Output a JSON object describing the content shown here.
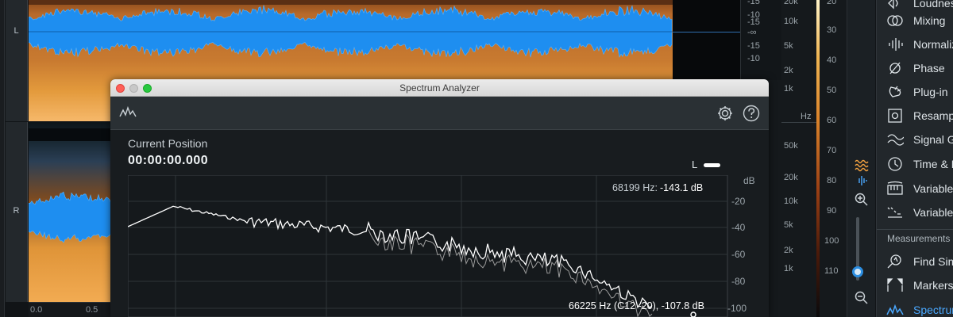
{
  "tracks": {
    "left_label": "L",
    "right_label": "R"
  },
  "time_ruler": [
    "0.0",
    "0.5"
  ],
  "db_ruler_top": [
    "-15",
    "-10",
    "-15",
    "-∞",
    "-15",
    "-10"
  ],
  "hz_ruler_top": [
    "20k",
    "10k",
    "5k",
    "2k",
    "1k"
  ],
  "hz_unit": "Hz",
  "hz_ruler_bottom": [
    "50k",
    "20k",
    "10k",
    "5k",
    "2k",
    "1k"
  ],
  "colorbar_ticks": [
    "20",
    "30",
    "40",
    "50",
    "60",
    "70",
    "80",
    "90",
    "100",
    "110"
  ],
  "modules": {
    "items": [
      {
        "label": "Loudness",
        "icon": "loudness-icon"
      },
      {
        "label": "Mixing",
        "icon": "mixing-icon"
      },
      {
        "label": "Normalize",
        "icon": "normalize-icon"
      },
      {
        "label": "Phase",
        "icon": "phase-icon"
      },
      {
        "label": "Plug-in",
        "icon": "plugin-icon"
      },
      {
        "label": "Resample",
        "icon": "resample-icon"
      },
      {
        "label": "Signal Generator",
        "icon": "signal-generator-icon"
      },
      {
        "label": "Time & Pitch",
        "icon": "time-pitch-icon"
      },
      {
        "label": "Variable Pitch",
        "icon": "variable-pitch-icon"
      },
      {
        "label": "Variable Time",
        "icon": "variable-time-icon"
      }
    ],
    "measurements_header": "Measurements",
    "measurement_items": [
      {
        "label": "Find Similar",
        "icon": "find-similar-icon"
      },
      {
        "label": "Markers",
        "icon": "markers-icon"
      },
      {
        "label": "Spectrum Analyzer",
        "icon": "spectrum-icon"
      }
    ]
  },
  "spectrum_window": {
    "title": "Spectrum Analyzer",
    "current_position_label": "Current Position",
    "current_time": "00:00:00.000",
    "channel": "L",
    "readout_top_hz": "68199 Hz:",
    "readout_top_db": "-143.1 dB",
    "readout_bottom": "66225 Hz (C12 -20), -107.8 dB",
    "y_unit": "dB",
    "y_ticks": [
      "-20",
      "-40",
      "-60",
      "-80",
      "-100"
    ],
    "colors": {
      "curve": "#ffffff",
      "grid": "#2f3539",
      "accent": "#2b8de0"
    }
  }
}
